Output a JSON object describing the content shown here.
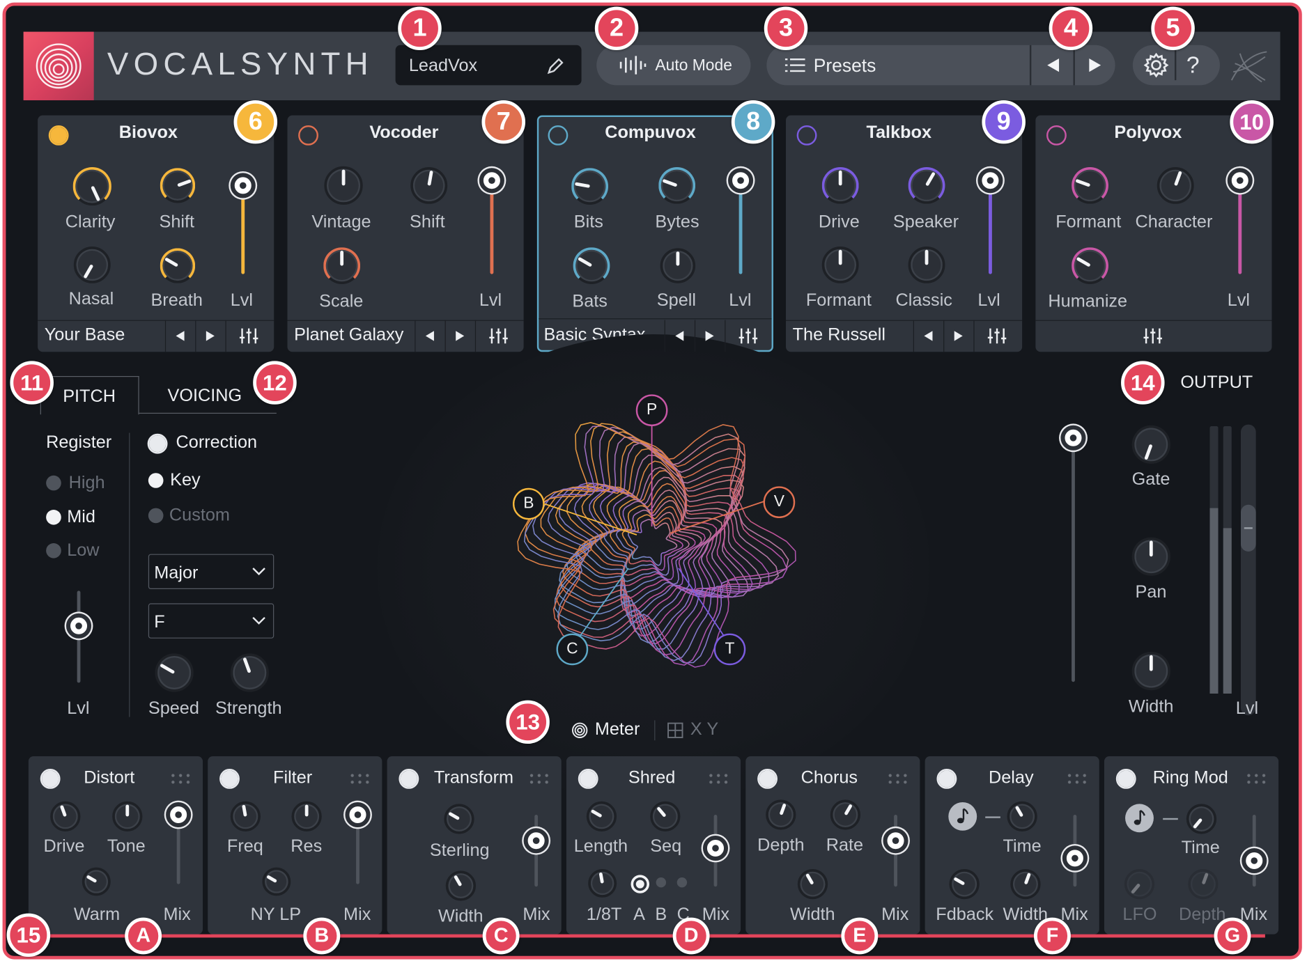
{
  "header": {
    "brand": "VOCALSYNTH",
    "preset_name": "LeadVox",
    "auto_mode": "Auto Mode",
    "presets": "Presets",
    "help": "?"
  },
  "badges": {
    "b1": "1",
    "b2": "2",
    "b3": "3",
    "b4": "4",
    "b5": "5",
    "b6": "6",
    "b7": "7",
    "b8": "8",
    "b9": "9",
    "b10": "10",
    "b11": "11",
    "b12": "12",
    "b13": "13",
    "b14": "14",
    "b15": "15",
    "bA": "A",
    "bB": "B",
    "bC": "C",
    "bD": "D",
    "bE": "E",
    "bF": "F",
    "bG": "G"
  },
  "modules": {
    "biovox": {
      "title": "Biovox",
      "k1": "Clarity",
      "k2": "Shift",
      "k3": "Nasal",
      "k4": "Breath",
      "lvl": "Lvl",
      "preset": "Your Base",
      "color": "#f6b73c"
    },
    "vocoder": {
      "title": "Vocoder",
      "k1": "Vintage",
      "k2": "Shift",
      "k3": "Scale",
      "lvl": "Lvl",
      "preset": "Planet Galaxy",
      "color": "#e07050"
    },
    "compuvox": {
      "title": "Compuvox",
      "k1": "Bits",
      "k2": "Bytes",
      "k3": "Bats",
      "k4": "Spell",
      "lvl": "Lvl",
      "preset": "Basic Syntax",
      "color": "#5ea9c8"
    },
    "talkbox": {
      "title": "Talkbox",
      "k1": "Drive",
      "k2": "Speaker",
      "k3": "Formant",
      "k4": "Classic",
      "lvl": "Lvl",
      "preset": "The Russell",
      "color": "#7b5ce0"
    },
    "polyvox": {
      "title": "Polyvox",
      "k1": "Formant",
      "k2": "Character",
      "k3": "Humanize",
      "lvl": "Lvl",
      "color": "#c957a6"
    }
  },
  "pitch": {
    "tab_pitch": "PITCH",
    "tab_voicing": "VOICING",
    "register": "Register",
    "high": "High",
    "mid": "Mid",
    "low": "Low",
    "lvl": "Lvl",
    "correction": "Correction",
    "key": "Key",
    "custom": "Custom",
    "scale": "Major",
    "root": "F",
    "speed": "Speed",
    "strength": "Strength"
  },
  "visualizer": {
    "p": "P",
    "b": "B",
    "v": "V",
    "c": "C",
    "t": "T",
    "meter": "Meter",
    "xy": "X Y"
  },
  "output": {
    "title": "OUTPUT",
    "gate": "Gate",
    "pan": "Pan",
    "width": "Width",
    "lvl": "Lvl"
  },
  "fx": {
    "distort": {
      "title": "Distort",
      "drive": "Drive",
      "tone": "Tone",
      "warm": "Warm",
      "mix": "Mix"
    },
    "filter": {
      "title": "Filter",
      "freq": "Freq",
      "res": "Res",
      "type": "NY LP",
      "mix": "Mix"
    },
    "transform": {
      "title": "Transform",
      "sterling": "Sterling",
      "width": "Width",
      "mix": "Mix"
    },
    "shred": {
      "title": "Shred",
      "length": "Length",
      "seq": "Seq",
      "rate": "1/8T",
      "a": "A",
      "b": "B",
      "c": "C",
      "mix": "Mix"
    },
    "chorus": {
      "title": "Chorus",
      "depth": "Depth",
      "rate": "Rate",
      "width": "Width",
      "mix": "Mix"
    },
    "delay": {
      "title": "Delay",
      "time": "Time",
      "fdback": "Fdback",
      "width": "Width",
      "mix": "Mix"
    },
    "ringmod": {
      "title": "Ring Mod",
      "time": "Time",
      "lfo": "LFO",
      "depth": "Depth",
      "mix": "Mix"
    }
  },
  "colors": {
    "frame_border": "#e84e63",
    "badge_red": "#e3455b",
    "biovox": "#f6b73c",
    "vocoder": "#e07050",
    "compuvox": "#5ea9c8",
    "talkbox": "#7b5ce0",
    "polyvox": "#c957a6"
  }
}
